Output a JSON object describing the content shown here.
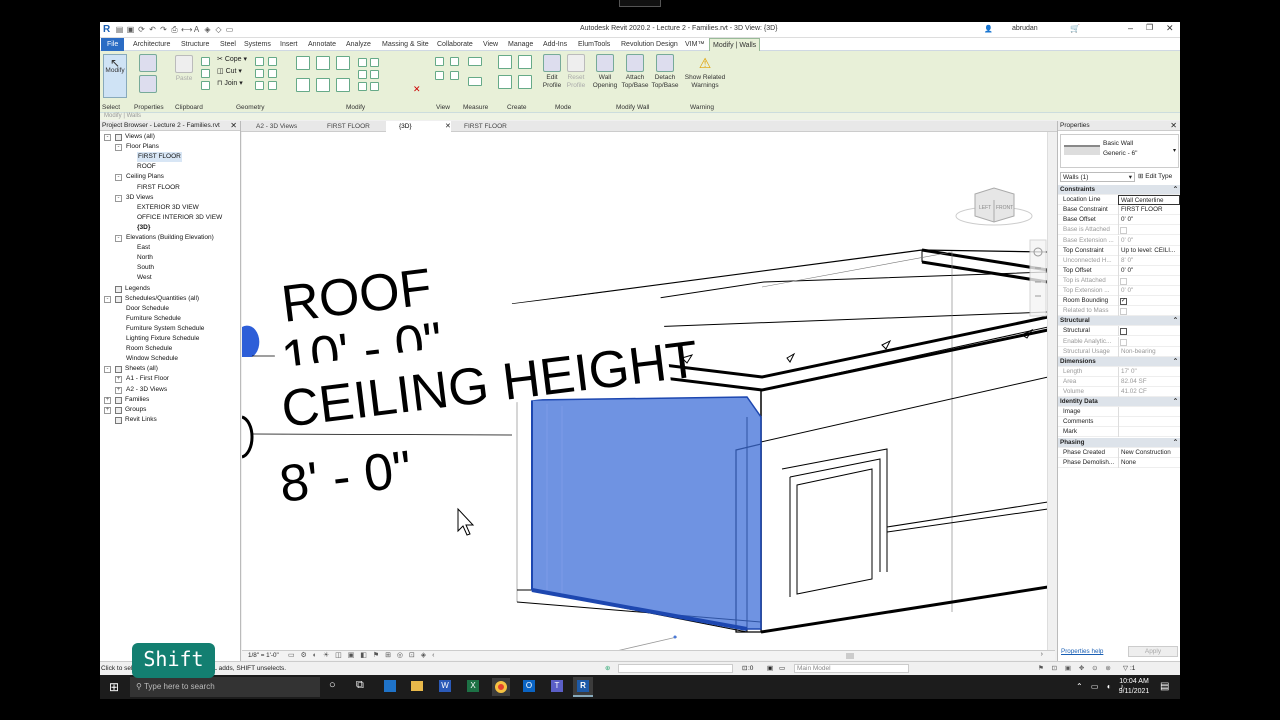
{
  "window": {
    "title": "Autodesk Revit 2020.2 - Lecture 2 - Families.rvt - 3D View: {3D}",
    "user": "abrudan"
  },
  "menu_tabs": [
    "File",
    "Architecture",
    "Structure",
    "Steel",
    "Systems",
    "Insert",
    "Annotate",
    "Analyze",
    "Massing & Site",
    "Collaborate",
    "View",
    "Manage",
    "Add-Ins",
    "ElumTools",
    "Revolution Design",
    "VIM™",
    "Modify | Walls"
  ],
  "ribbon": {
    "modify_label": "Modify",
    "cope": "Cope",
    "cut": "Cut",
    "join": "Join",
    "paste": "Paste",
    "buttons": {
      "edit_profile": "Edit\nProfile",
      "reset_profile": "Reset\nProfile",
      "wall_opening": "Wall\nOpening",
      "attach": "Attach\nTop/Base",
      "detach": "Detach\nTop/Base",
      "show_related": "Show Related\nWarnings"
    },
    "panels": [
      "Select",
      "Properties",
      "Clipboard",
      "Geometry",
      "Modify",
      "View",
      "Measure",
      "Create",
      "Mode",
      "Modify Wall",
      "Warning"
    ]
  },
  "context_line": "Modify | Walls",
  "project_browser": {
    "title": "Project Browser - Lecture 2 - Families.rvt",
    "items": [
      {
        "label": "Views (all)",
        "level": 0,
        "toggle": "-",
        "icon": true
      },
      {
        "label": "Floor Plans",
        "level": 1,
        "toggle": "-"
      },
      {
        "label": "FIRST FLOOR",
        "level": 2,
        "selected": true
      },
      {
        "label": "ROOF",
        "level": 2
      },
      {
        "label": "Ceiling Plans",
        "level": 1,
        "toggle": "-"
      },
      {
        "label": "FIRST FLOOR",
        "level": 2
      },
      {
        "label": "3D Views",
        "level": 1,
        "toggle": "-"
      },
      {
        "label": "EXTERIOR 3D VIEW",
        "level": 2
      },
      {
        "label": "OFFICE INTERIOR 3D VIEW",
        "level": 2
      },
      {
        "label": "{3D}",
        "level": 2,
        "bold": true
      },
      {
        "label": "Elevations (Building Elevation)",
        "level": 1,
        "toggle": "-"
      },
      {
        "label": "East",
        "level": 2
      },
      {
        "label": "North",
        "level": 2
      },
      {
        "label": "South",
        "level": 2
      },
      {
        "label": "West",
        "level": 2
      },
      {
        "label": "Legends",
        "level": 0,
        "icon": true
      },
      {
        "label": "Schedules/Quantities (all)",
        "level": 0,
        "toggle": "-",
        "icon": true
      },
      {
        "label": "Door Schedule",
        "level": 1
      },
      {
        "label": "Furniture Schedule",
        "level": 1
      },
      {
        "label": "Furniture System Schedule",
        "level": 1
      },
      {
        "label": "Lighting Fixture Schedule",
        "level": 1
      },
      {
        "label": "Room Schedule",
        "level": 1
      },
      {
        "label": "Window Schedule",
        "level": 1
      },
      {
        "label": "Sheets (all)",
        "level": 0,
        "toggle": "-",
        "icon": true
      },
      {
        "label": "A1 - First Floor",
        "level": 1,
        "toggle": "+"
      },
      {
        "label": "A2 - 3D Views",
        "level": 1,
        "toggle": "+"
      },
      {
        "label": "Families",
        "level": 0,
        "toggle": "+",
        "icon": true
      },
      {
        "label": "Groups",
        "level": 0,
        "toggle": "+",
        "icon": true
      },
      {
        "label": "Revit Links",
        "level": 0,
        "icon": true
      }
    ]
  },
  "view_tabs": [
    "A2 - 3D Views",
    "FIRST FLOOR",
    "{3D}",
    "FIRST FLOOR"
  ],
  "viewport": {
    "roof_label": "ROOF",
    "roof_hidden": "10' - 0\"",
    "ceiling_label": "CEILING HEIGHT",
    "ceiling_value": "8' - 0\"",
    "cube_left": "LEFT",
    "cube_front": "FRONT"
  },
  "view_bar": {
    "scale": "1/8\" = 1'-0\""
  },
  "properties": {
    "title": "Properties",
    "type_family": "Basic Wall",
    "type_name": "Generic - 6\"",
    "selector": "Walls (1)",
    "edit_type": "Edit Type",
    "sections": [
      {
        "name": "Constraints",
        "rows": [
          {
            "k": "Location Line",
            "v": "Wall Centerline"
          },
          {
            "k": "Base Constraint",
            "v": "FIRST FLOOR"
          },
          {
            "k": "Base Offset",
            "v": "0'  0\""
          },
          {
            "k": "Base is Attached",
            "v": "",
            "dim": true,
            "check": true
          },
          {
            "k": "Base Extension ...",
            "v": "0'  0\"",
            "dim": true
          },
          {
            "k": "Top Constraint",
            "v": "Up to level: CEILI..."
          },
          {
            "k": "Unconnected H...",
            "v": "8'  0\"",
            "dim": true
          },
          {
            "k": "Top Offset",
            "v": "0'  0\""
          },
          {
            "k": "Top is Attached",
            "v": "",
            "dim": true,
            "check": true
          },
          {
            "k": "Top Extension ...",
            "v": "0'  0\"",
            "dim": true
          },
          {
            "k": "Room Bounding",
            "v": "",
            "check": true,
            "checked": true
          },
          {
            "k": "Related to Mass",
            "v": "",
            "dim": true,
            "check": true
          }
        ]
      },
      {
        "name": "Structural",
        "rows": [
          {
            "k": "Structural",
            "v": "",
            "check": true
          },
          {
            "k": "Enable Analytic...",
            "v": "",
            "dim": true,
            "check": true
          },
          {
            "k": "Structural Usage",
            "v": "Non-bearing",
            "dim": true
          }
        ]
      },
      {
        "name": "Dimensions",
        "rows": [
          {
            "k": "Length",
            "v": "17'  0\"",
            "dim": true
          },
          {
            "k": "Area",
            "v": "82.04 SF",
            "dim": true
          },
          {
            "k": "Volume",
            "v": "41.02 CF",
            "dim": true
          }
        ]
      },
      {
        "name": "Identity Data",
        "rows": [
          {
            "k": "Image",
            "v": ""
          },
          {
            "k": "Comments",
            "v": ""
          },
          {
            "k": "Mark",
            "v": ""
          }
        ]
      },
      {
        "name": "Phasing",
        "rows": [
          {
            "k": "Phase Created",
            "v": "New Construction"
          },
          {
            "k": "Phase Demolish...",
            "v": "None"
          }
        ]
      }
    ],
    "help_link": "Properties help",
    "apply": "Apply"
  },
  "status": {
    "text": "Click to select, TAB for alternates, CTRL adds, SHIFT unselects.",
    "zero": ":0",
    "model": "Main Model",
    "filter": ":1"
  },
  "taskbar": {
    "search": "Type here to search",
    "time": "10:04 AM",
    "date": "9/11/2021"
  },
  "overlay": {
    "key": "Shift"
  }
}
